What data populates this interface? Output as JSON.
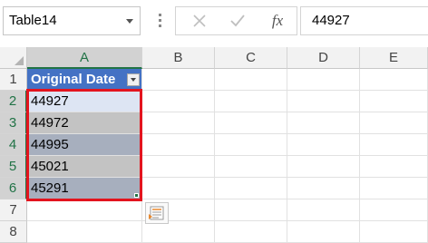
{
  "formula_bar": {
    "name_box": "Table14",
    "cancel_icon": "x-icon",
    "enter_icon": "checkmark-icon",
    "fx_label": "fx",
    "formula_value": "44927"
  },
  "columns": [
    {
      "label": "A",
      "selected": true
    },
    {
      "label": "B",
      "selected": false
    },
    {
      "label": "C",
      "selected": false
    },
    {
      "label": "D",
      "selected": false
    },
    {
      "label": "E",
      "selected": false
    }
  ],
  "rows": [
    {
      "label": "1",
      "selected": false
    },
    {
      "label": "2",
      "selected": true
    },
    {
      "label": "3",
      "selected": true
    },
    {
      "label": "4",
      "selected": true
    },
    {
      "label": "5",
      "selected": true
    },
    {
      "label": "6",
      "selected": true
    },
    {
      "label": "7",
      "selected": false
    },
    {
      "label": "8",
      "selected": false
    }
  ],
  "table": {
    "header": "Original Date",
    "values": [
      "44927",
      "44972",
      "44995",
      "45021",
      "45291"
    ]
  },
  "colors": {
    "table_header": "#4472c4",
    "selection_outline": "#e3141e",
    "excel_green": "#217346"
  }
}
